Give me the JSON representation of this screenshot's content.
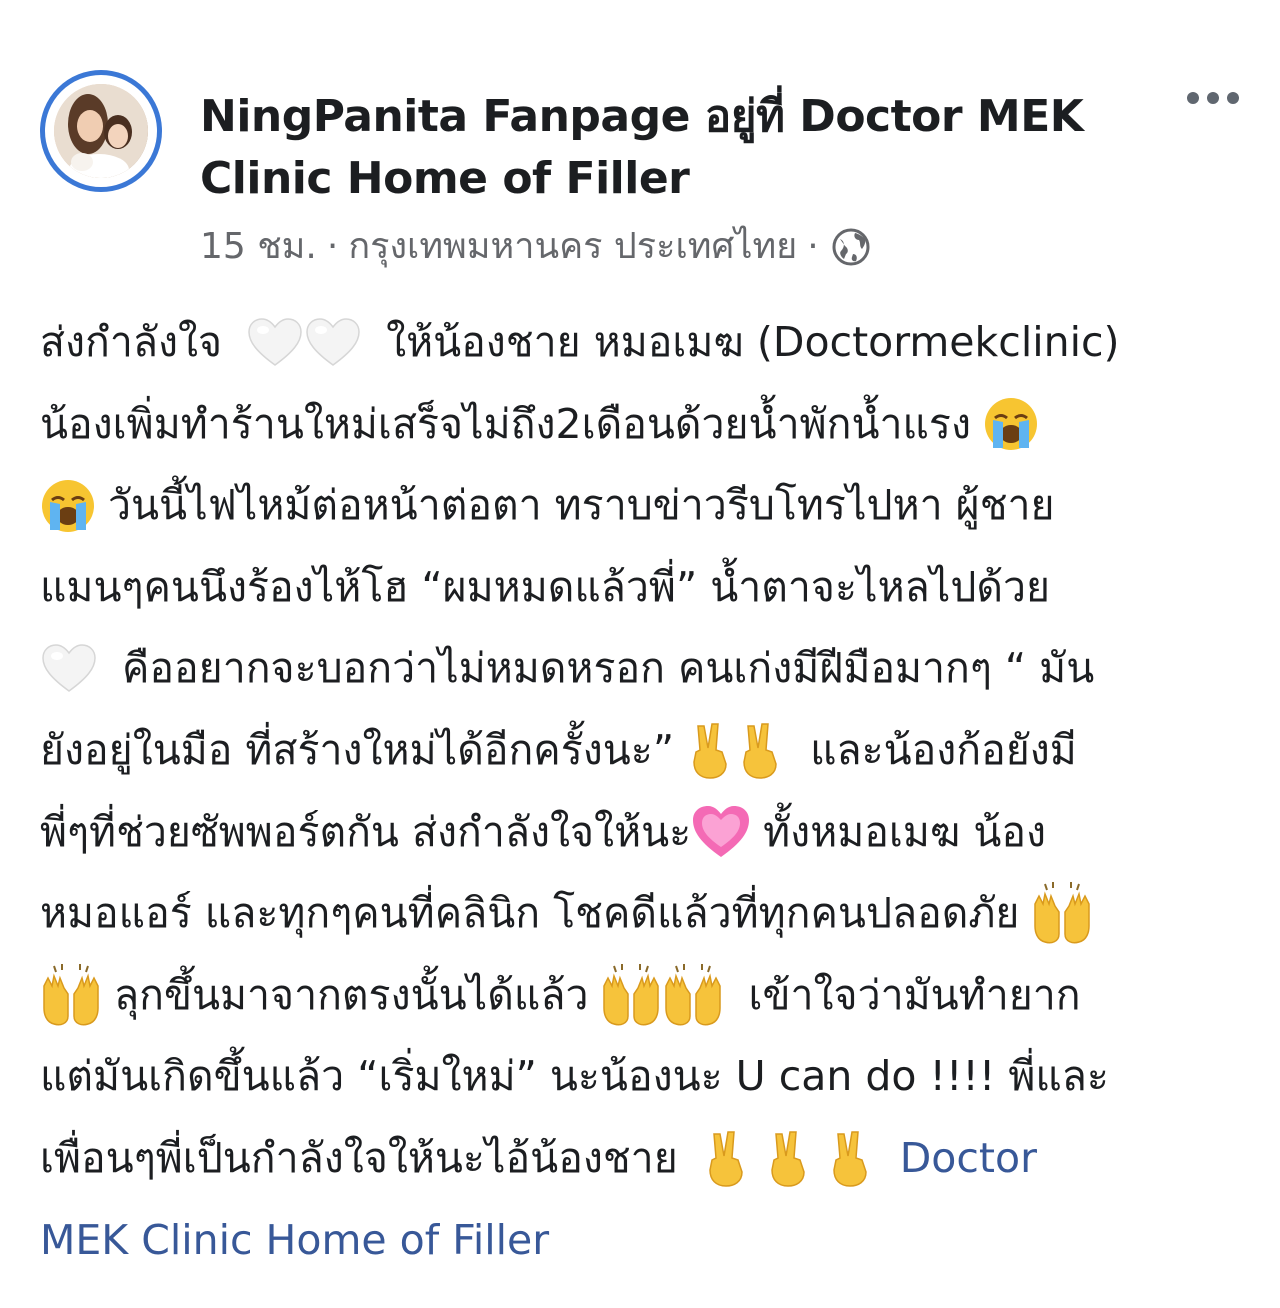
{
  "post": {
    "author_line_1": "NingPanita Fanpage อยู่ที่ Doctor MEK",
    "author_line_2": "Clinic Home of Filler",
    "time": "15 ชม.",
    "separator": "·",
    "location": "กรุงเทพมหานคร ประเทศไทย",
    "privacy_icon": "globe-icon",
    "more_icon": "more-options-icon",
    "colors": {
      "accent_ring": "#3b78d6",
      "link": "#385898",
      "meta": "#65676b",
      "text": "#1c1e21"
    }
  },
  "body": {
    "l1a": "ส่งกำลังใจ",
    "l1b": "ให้น้องชาย หมอเมฆ (Doctormekclinic)",
    "l2a": "น้องเพิ่มทำร้านใหม่เสร็จไม่ถึง2เดือนด้วยน้ำพักน้ำแรง",
    "l3a": "วันนี้ไฟไหม้ต่อหน้าต่อตา ทราบข่าวรีบโทรไปหา ผู้ชาย",
    "l4a": "แมนๆคนนึงร้องไห้โฮ “ผมหมดแล้วพี่” น้ำตาจะไหลไปด้วย",
    "l5a": "คืออยากจะบอกว่าไม่หมดหรอก คนเก่งมีฝีมือมากๆ “ มัน",
    "l6a": "ยังอยู่ในมือ ที่สร้างใหม่ได้อีกครั้งนะ”",
    "l6b": "และน้องก้อยังมี",
    "l7a": "พี่ๆที่ช่วยซัพพอร์ตกัน ส่งกำลังใจให้นะ",
    "l7b": "ทั้งหมอเมฆ น้อง",
    "l8a": "หมอแอร์ และทุกๆคนที่คลินิก โชคดีแล้วที่ทุกคนปลอดภัย",
    "l9a": "ลุกขึ้นมาจากตรงนั้นได้แล้ว",
    "l9b": "เข้าใจว่ามันทำยาก",
    "l10a": "แต่มันเกิดขึ้นแล้ว “เริ่มใหม่” นะน้องนะ U can do !!!! พี่และ",
    "l11a": "เพื่อนๆพี่เป็นกำลังใจให้นะไอ้น้องชาย",
    "l11link": "Doctor",
    "l12link": "MEK Clinic Home of Filler",
    "emoji_names": [
      "white-heart",
      "loudly-crying-face",
      "victory-hand",
      "raising-hands",
      "growing-heart"
    ]
  }
}
